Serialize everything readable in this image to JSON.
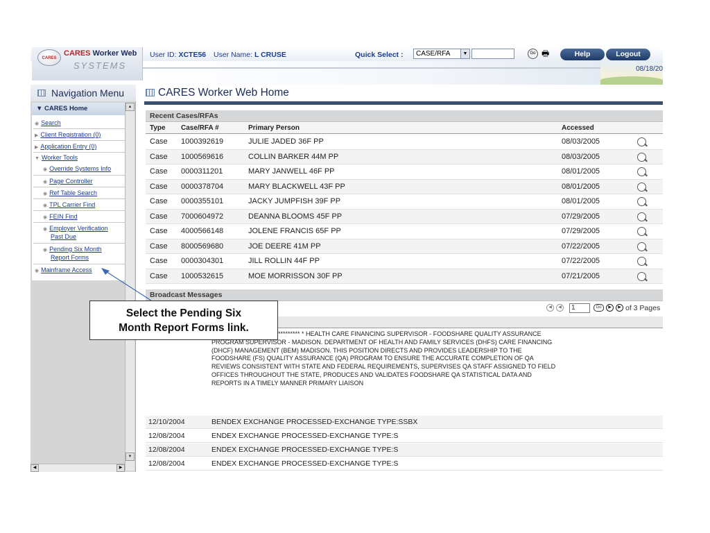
{
  "header": {
    "app_name_red": "CARES",
    "app_name_blue": "Worker Web",
    "app_sub": "SYSTEMS",
    "logo_badge": "CARES",
    "user_id_label": "User ID:",
    "user_id": "XCTE56",
    "user_name_label": "User Name:",
    "user_name": "L CRUSE",
    "quick_select_label": "Quick Select :",
    "quick_select_value": "CASE/RFA",
    "go_label": "Go",
    "help_label": "Help",
    "logout_label": "Logout",
    "date": "08/18/20"
  },
  "nav": {
    "title": "Navigation Menu",
    "home": "CARES Home",
    "items": [
      {
        "label": "Search"
      },
      {
        "label": "Client Registration (0)"
      },
      {
        "label": "Application Entry (0)"
      },
      {
        "label": "Worker Tools"
      },
      {
        "label": "Override Systems Info"
      },
      {
        "label": "Page Controller"
      },
      {
        "label": "Ref Table Search"
      },
      {
        "label": "TPL Carrier Find"
      },
      {
        "label": "FEIN Find"
      },
      {
        "label": "Employer Verification"
      },
      {
        "label": "Past Due"
      },
      {
        "label": "Pending Six Month"
      },
      {
        "label": "Report Forms"
      },
      {
        "label": "Mainframe Access"
      }
    ]
  },
  "main": {
    "title": "CARES Worker Web Home",
    "recent_header": "Recent Cases/RFAs",
    "columns": [
      "Type",
      "Case/RFA #",
      "Primary Person",
      "Accessed"
    ],
    "cases": [
      {
        "type": "Case",
        "number": "1000392619",
        "person": "JULIE JADED 36F PP",
        "accessed": "08/03/2005"
      },
      {
        "type": "Case",
        "number": "1000569616",
        "person": "COLLIN BARKER 44M PP",
        "accessed": "08/03/2005"
      },
      {
        "type": "Case",
        "number": "0000311201",
        "person": "MARY JANWELL 46F PP",
        "accessed": "08/01/2005"
      },
      {
        "type": "Case",
        "number": "0000378704",
        "person": "MARY BLACKWELL 43F PP",
        "accessed": "08/01/2005"
      },
      {
        "type": "Case",
        "number": "0000355101",
        "person": "JACKY JUMPFISH 39F PP",
        "accessed": "08/01/2005"
      },
      {
        "type": "Case",
        "number": "7000604972",
        "person": "DEANNA BLOOMS 45F PP",
        "accessed": "07/29/2005"
      },
      {
        "type": "Case",
        "number": "4000566148",
        "person": "JOLENE FRANCIS 65F PP",
        "accessed": "07/29/2005"
      },
      {
        "type": "Case",
        "number": "8000569680",
        "person": "JOE DEERE 41M PP",
        "accessed": "07/22/2005"
      },
      {
        "type": "Case",
        "number": "0000304301",
        "person": "JILL ROLLIN 44F PP",
        "accessed": "07/22/2005"
      },
      {
        "type": "Case",
        "number": "1000532615",
        "person": "MOE MORRISSON 30F PP",
        "accessed": "07/21/2005"
      }
    ],
    "broadcast_header": "Broadcast Messages",
    "pager": {
      "page": "1",
      "of_text": "of 3 Pages",
      "go": "Go"
    },
    "desc_header_visible": "on",
    "long_message": "ANCOUCMENT****************** * HEALTH CARE FINANCING SUPERVISOR - FOODSHARE QUALITY ASSURANCE PROGRAM SUPERVISOR - MADISON. DEPARTMENT OF HEALTH AND FAMILY SERVICES (DHFS) CARE FINANCING (DHCF) MANAGEMENT (BEM) MADISON. THIS POSITION DIRECTS AND PROVIDES LEADERSHIP TO THE FOODSHARE (FS) QUALITY ASSURANCE (QA) PROGRAM TO ENSURE THE ACCURATE COMPLETION OF QA REVIEWS CONSISTENT WITH STATE AND FEDERAL REQUIREMENTS, SUPERVISES QA STAFF ASSIGNED TO FIELD OFFICES THROUGHOUT THE STATE, PRODUCES AND VALIDATES FOODSHARE QA STATISTICAL DATA AND REPORTS IN A TIMELY MANNER PRIMARY LIAISON",
    "messages": [
      {
        "date": "12/10/2004",
        "text": "BENDEX EXCHANGE PROCESSED-EXCHANGE TYPE:SSBX"
      },
      {
        "date": "12/08/2004",
        "text": "ENDEX EXCHANGE PROCESSED-EXCHANGE TYPE:S"
      },
      {
        "date": "12/08/2004",
        "text": "ENDEX EXCHANGE PROCESSED-EXCHANGE TYPE:S"
      },
      {
        "date": "12/08/2004",
        "text": "ENDEX EXCHANGE PROCESSED-EXCHANGE TYPE:S"
      }
    ]
  },
  "callout": {
    "line1": "Select the Pending Six",
    "line2": "Month Report Forms link."
  },
  "colors": {
    "navy": "#1b2b59",
    "brand_red": "#b3262c",
    "link_blue": "#1b3b8c",
    "rule": "#3b4e6d"
  }
}
